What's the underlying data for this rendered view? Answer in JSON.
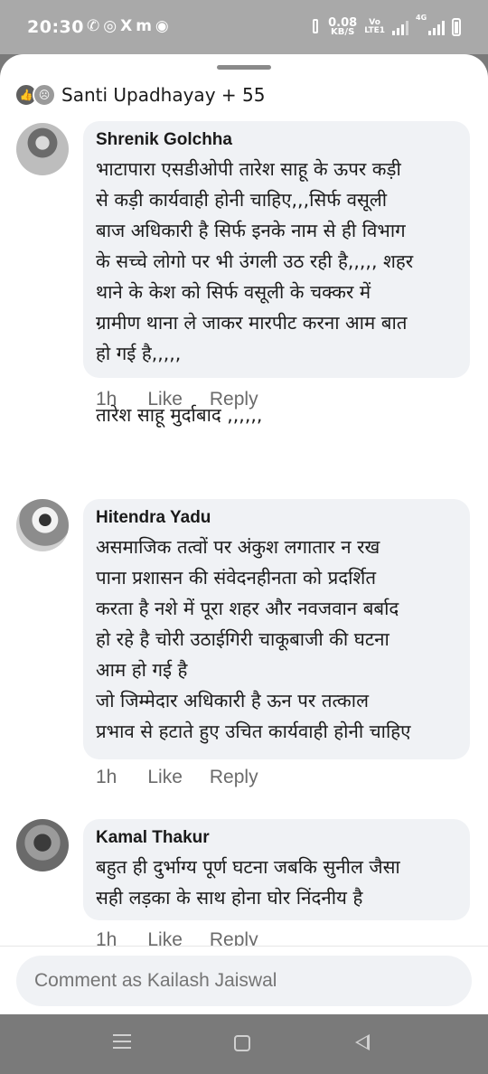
{
  "status_bar": {
    "time": "20:30",
    "notification_icons": [
      "whatsapp-icon",
      "instagram-icon",
      "x-icon",
      "m-icon",
      "messenger-icon"
    ],
    "speed_value": "0.08",
    "speed_unit": "KB/S",
    "volte_top": "Vo",
    "volte_bottom": "LTE1",
    "network_label": "4G"
  },
  "reactions": {
    "names": "Santi Upadhayay + 55",
    "icons": [
      "like-icon",
      "sad-icon"
    ]
  },
  "comments": [
    {
      "author": "Shrenik Golchha",
      "text": "भाटापारा एसडीओपी तारेश साहू के ऊपर कड़ी\nसे कड़ी कार्यवाही होनी चाहिए,,,सिर्फ वसूली\nबाज अधिकारी है सिर्फ इनके नाम से ही विभाग\nके सच्चे लोगो पर भी उंगली उठ रही है,,,,, शहर\nथाने के केश को सिर्फ वसूली के चक्कर में\nग्रामीण थाना ले जाकर मारपीट करना आम बात\nहो गई है,,,,,\n\nतारेश साहू मुर्दाबाद ,,,,,,",
      "time": "1h",
      "like_label": "Like",
      "reply_label": "Reply"
    },
    {
      "author": "Hitendra Yadu",
      "text": "असमाजिक तत्वों पर अंकुश लगातार न रख\nपाना प्रशासन की संवेदनहीनता को प्रदर्शित\nकरता है नशे में पूरा शहर और नवजवान बर्बाद\nहो रहे है चोरी उठाईगिरी चाकूबाजी की घटना\nआम हो गई है\nजो जिम्मेदार अधिकारी है ऊन पर तत्काल\nप्रभाव से हटाते हुए उचित कार्यवाही  होनी चाहिए",
      "time": "1h",
      "like_label": "Like",
      "reply_label": "Reply"
    },
    {
      "author": "Kamal Thakur",
      "text": "बहुत ही दुर्भाग्य पूर्ण घटना  जबकि सुनील जैसा\nसही लड़का के साथ होना घोर निंदनीय है",
      "time": "1h",
      "like_label": "Like",
      "reply_label": "Reply"
    }
  ],
  "composer": {
    "placeholder": "Comment as Kailash Jaiswal"
  },
  "nav_bar": {
    "buttons": [
      "menu-icon",
      "home-icon",
      "back-icon"
    ]
  }
}
